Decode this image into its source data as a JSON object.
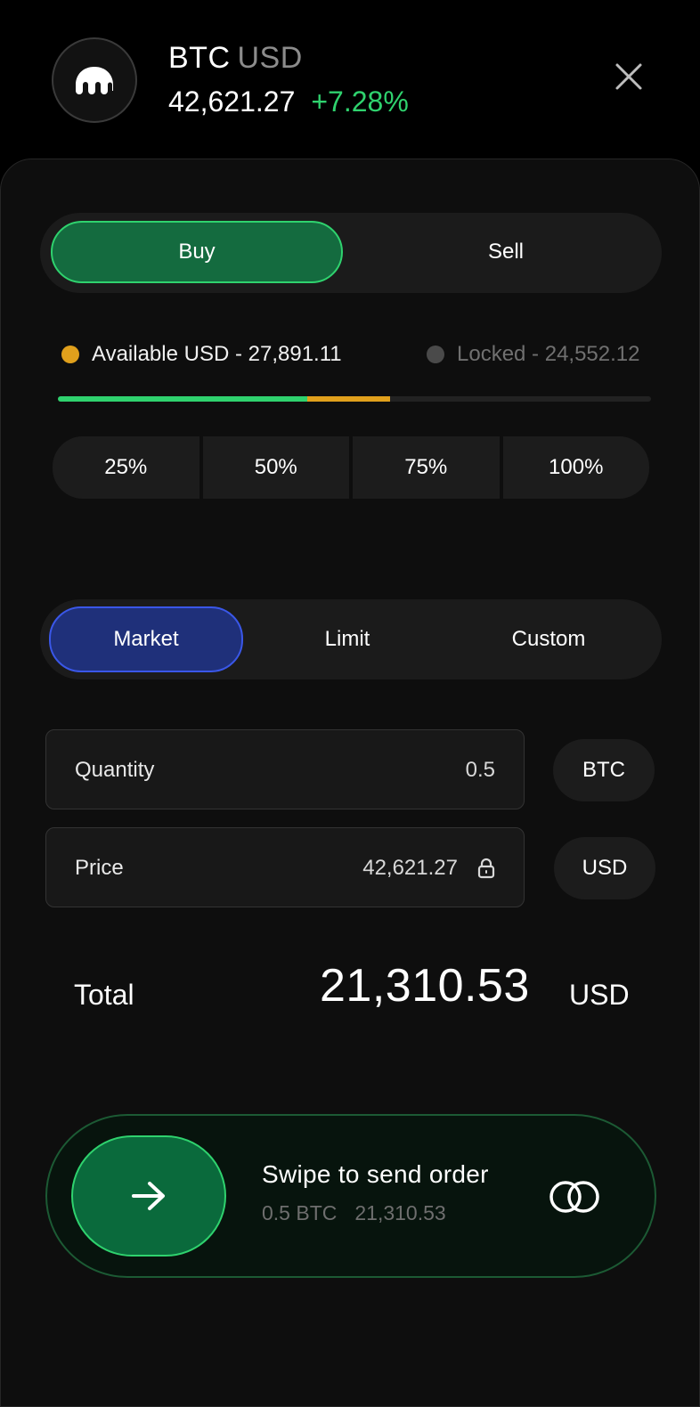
{
  "header": {
    "base": "BTC",
    "quote": "USD",
    "price": "42,621.27",
    "change": "+7.28%",
    "logo_icon": "kraken-logo-icon",
    "close_icon": "close-icon"
  },
  "side_toggle": {
    "buy_label": "Buy",
    "sell_label": "Sell",
    "selected": "Buy"
  },
  "balances": {
    "available_label": "Available USD - 27,891.11",
    "locked_label": "Locked - 24,552.12",
    "available_fraction": 0.42,
    "locked_fraction": 0.14
  },
  "percent_buttons": [
    "25%",
    "50%",
    "75%",
    "100%"
  ],
  "order_types": {
    "market": "Market",
    "limit": "Limit",
    "custom": "Custom",
    "selected": "Market"
  },
  "fields": {
    "quantity_label": "Quantity",
    "quantity_value": "0.5",
    "quantity_unit": "BTC",
    "price_label": "Price",
    "price_value": "42,621.27",
    "price_unit": "USD",
    "price_icon": "lock-icon"
  },
  "total": {
    "label": "Total",
    "value": "21,310.53",
    "unit": "USD"
  },
  "swipe": {
    "title": "Swipe to send order",
    "sub_qty": "0.5 BTC",
    "sub_amount": "21,310.53",
    "handle_icon": "arrow-right-icon",
    "trailing_icon": "double-circle-icon"
  },
  "colors": {
    "background": "#000000",
    "sheet": "#0e0e0e",
    "positive": "#2fd26e",
    "buy_fill": "#146b3f",
    "market_fill": "#1f307a",
    "market_border": "#3a57e8",
    "available_dot": "#e0a01c",
    "locked_dot": "#4a4a4a",
    "progress_available": "#2fd26e",
    "progress_locked": "#e0a01c"
  }
}
